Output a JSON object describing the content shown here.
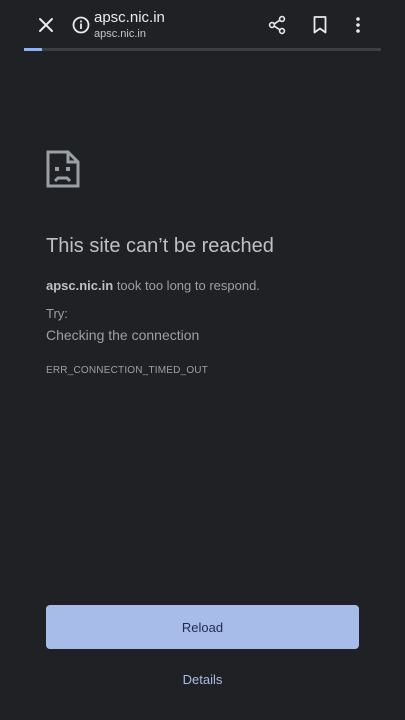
{
  "toolbar": {
    "url_title": "apsc.nic.in",
    "url_subtitle": "apsc.nic.in",
    "close_icon": "close-icon",
    "info_icon": "info-icon",
    "share_icon": "share-icon",
    "bookmark_icon": "bookmark-icon",
    "menu_icon": "menu-icon",
    "progress_fraction": 0.05
  },
  "error": {
    "icon": "sad-document-icon",
    "title": "This site can’t be reached",
    "host": "apsc.nic.in",
    "message": " took too long to respond.",
    "try_label": "Try:",
    "suggestion": "Checking the connection",
    "code": "ERR_CONNECTION_TIMED_OUT"
  },
  "actions": {
    "reload_label": "Reload",
    "details_label": "Details"
  },
  "colors": {
    "background": "#202124",
    "accent": "#a8bce9",
    "text": "#bdc1c6"
  }
}
